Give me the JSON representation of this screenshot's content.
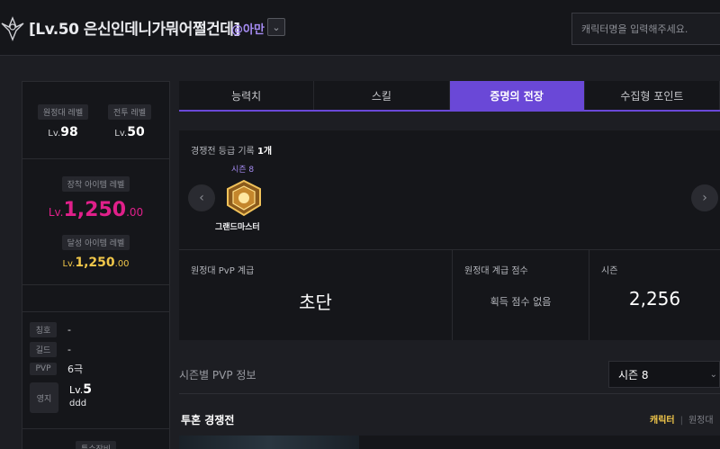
{
  "header": {
    "title": "[Lv.50 은신인데니가뭐어쩔건데]",
    "server": "@아만",
    "search_placeholder": "캐릭터명을 입력해주세요."
  },
  "levels": {
    "expedition_label": "원정대 레벨",
    "expedition_prefix": "Lv.",
    "expedition_value": "98",
    "combat_label": "전투 레벨",
    "combat_prefix": "Lv.",
    "combat_value": "50"
  },
  "item_level": {
    "equipped_label": "장착 아이템 레벨",
    "equipped_prefix": "Lv.",
    "equipped_main": "1,250",
    "equipped_decimal": ".00",
    "achieved_label": "달성 아이템 레벨",
    "achieved_prefix": "Lv.",
    "achieved_main": "1,250",
    "achieved_decimal": ".00"
  },
  "info": {
    "title_label": "칭호",
    "title_value": "-",
    "guild_label": "길드",
    "guild_value": "-",
    "pvp_label": "PVP",
    "pvp_value": "6극",
    "estate_label": "영지",
    "estate_prefix": "Lv.",
    "estate_level": "5",
    "estate_name": "ddd",
    "special_label": "특수장비"
  },
  "tabs": [
    "능력치",
    "스킬",
    "증명의 전장",
    "수집형 포인트"
  ],
  "proving": {
    "record_label": "경쟁전 등급 기록",
    "record_count": "1개",
    "season": "시즌 8",
    "badge_name": "그랜드마스터",
    "stats": {
      "grade_label": "원정대 PvP 계급",
      "grade_value": "초단",
      "score_label": "원정대 계급 점수",
      "score_value": "획득 점수 없음",
      "season_label": "시즌",
      "season_value": "2,256"
    }
  },
  "season_pvp": {
    "title": "시즌별 PVP 정보",
    "selected": "시즌 8",
    "duel_title": "투혼 경쟁전",
    "tab_character": "캐릭터",
    "tab_expedition": "원정대"
  },
  "colors": {
    "accent": "#6a48d7",
    "pink": "#e0208a",
    "gold": "#f0c64a",
    "purple_text": "#a58bf2"
  }
}
